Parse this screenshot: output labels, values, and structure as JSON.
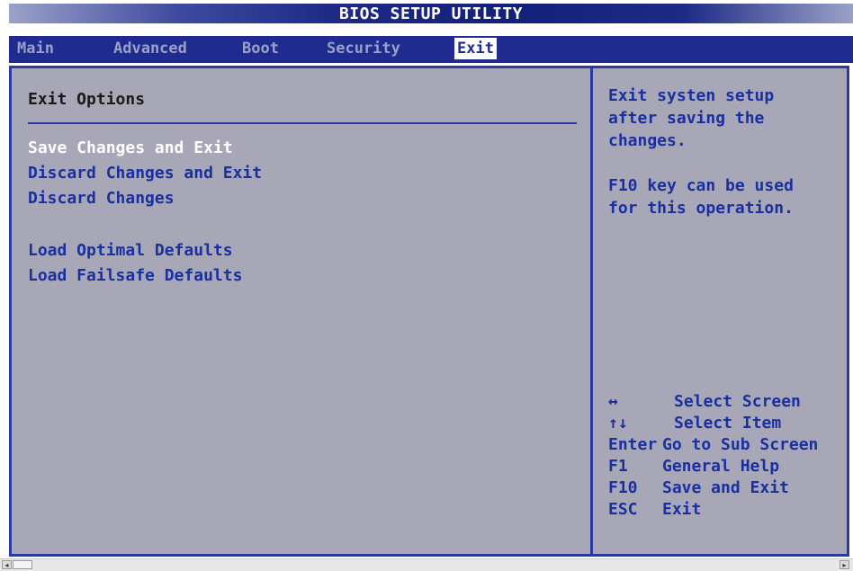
{
  "title": "BIOS SETUP UTILITY",
  "menu": {
    "items": [
      {
        "label": "Main"
      },
      {
        "label": "Advanced"
      },
      {
        "label": "Boot"
      },
      {
        "label": "Security"
      },
      {
        "label": "Exit"
      }
    ],
    "active": "Exit"
  },
  "left": {
    "section_title": "Exit Options",
    "options": [
      {
        "label": "Save Changes and Exit"
      },
      {
        "label": "Discard Changes and Exit"
      },
      {
        "label": "Discard Changes"
      },
      {
        "label": "Load Optimal Defaults"
      },
      {
        "label": "Load Failsafe Defaults"
      }
    ]
  },
  "help": {
    "lines": [
      "Exit systen setup",
      "after saving the",
      "changes.",
      "",
      "F10 key can be used",
      "for this operation."
    ]
  },
  "keys": [
    {
      "key": "↔",
      "desc": "Select Screen"
    },
    {
      "key": "↑↓",
      "desc": "Select Item"
    },
    {
      "key": "Enter",
      "desc": "Go to Sub Screen"
    },
    {
      "key": "F1",
      "desc": "General Help"
    },
    {
      "key": "F10",
      "desc": "Save and Exit"
    },
    {
      "key": "ESC",
      "desc": "Exit"
    }
  ],
  "colors": {
    "title_bg": "#13207a",
    "menu_bg": "#1f2b8e",
    "panel_bg": "#a7a7b7",
    "option_text": "#1a2fa0",
    "selected_text": "#ffffff"
  }
}
